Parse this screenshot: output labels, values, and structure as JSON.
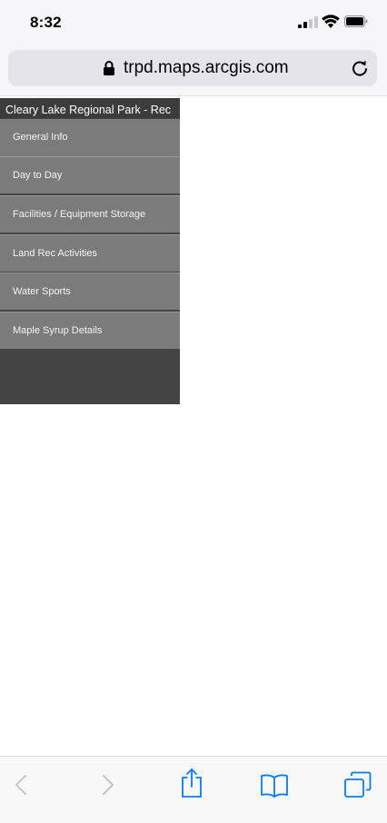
{
  "status_bar": {
    "time": "8:32"
  },
  "url_bar": {
    "url": "trpd.maps.arcgis.com"
  },
  "sidebar": {
    "title": "Cleary Lake Regional Park - Rec",
    "items": [
      {
        "label": "General Info"
      },
      {
        "label": "Day to Day"
      },
      {
        "label": "Facilities / Equipment Storage"
      },
      {
        "label": "Land Rec Activities"
      },
      {
        "label": "Water Sports"
      },
      {
        "label": "Maple Syrup Details"
      }
    ]
  },
  "colors": {
    "sidebar_dark": "#444444",
    "menu_item_bg": "#7b7b7b",
    "accent_blue": "#0a7aff"
  },
  "icons": [
    "signal-icon",
    "wifi-icon",
    "battery-icon",
    "lock-icon",
    "reload-icon",
    "back-icon",
    "forward-icon",
    "share-icon",
    "bookmarks-icon",
    "tabs-icon"
  ]
}
